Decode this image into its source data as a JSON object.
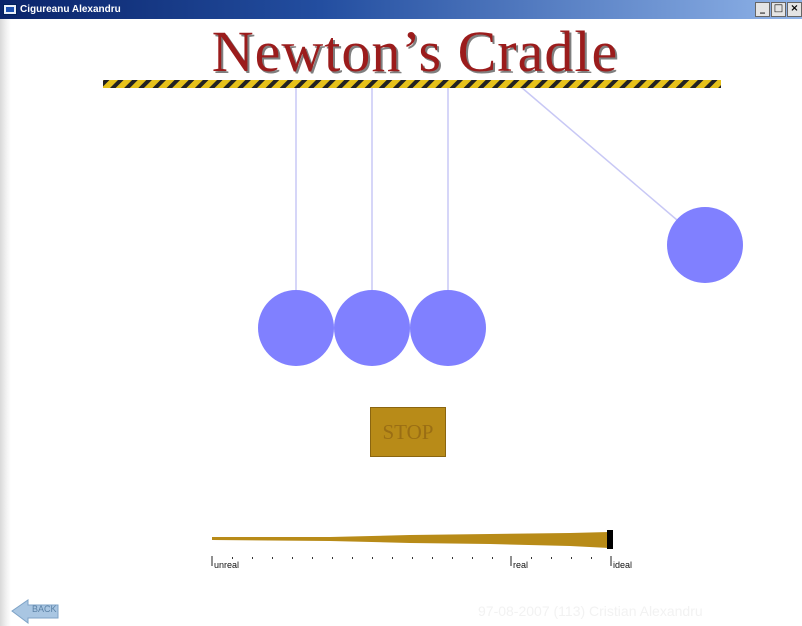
{
  "window": {
    "title": "Cigureanu Alexandru",
    "controls": [
      "_",
      "□",
      "×"
    ]
  },
  "scene": {
    "heading": "Newton’s Cradle",
    "balls_count": 4,
    "swinging_ball_index": 3,
    "string_color": "#c8c8f5",
    "ball_color": "#8080ff",
    "beam_colors": [
      "#e6c11a",
      "#222222"
    ]
  },
  "stop_button": {
    "label": "STOP",
    "color": "#b88b18"
  },
  "realism_slider": {
    "labels": [
      "unreal",
      "real",
      "ideal"
    ],
    "value_fraction": 1.0,
    "color": "#b88b18"
  },
  "back_button": {
    "label": "BACK"
  },
  "watermark": "97-08-2007 (113) Cristian Alexandru"
}
